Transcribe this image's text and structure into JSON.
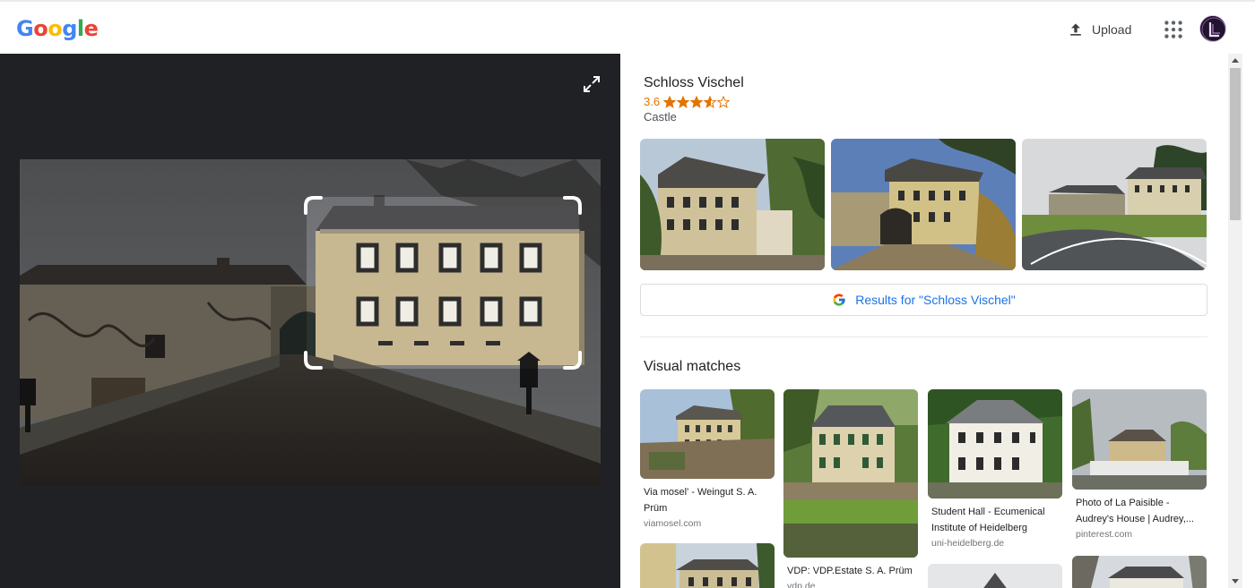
{
  "header": {
    "logo_letters": [
      {
        "ch": "G",
        "color": "#4285F4"
      },
      {
        "ch": "o",
        "color": "#EA4335"
      },
      {
        "ch": "o",
        "color": "#FBBC05"
      },
      {
        "ch": "g",
        "color": "#4285F4"
      },
      {
        "ch": "l",
        "color": "#34A853"
      },
      {
        "ch": "e",
        "color": "#EA4335"
      }
    ],
    "upload_label": "Upload",
    "upload_icon": "upload-icon",
    "apps_icon": "apps-grid-icon"
  },
  "viewer": {
    "expand_icon": "expand-icon",
    "background": "#202124"
  },
  "entity": {
    "title": "Schloss Vischel",
    "rating": "3.6",
    "stars_value": 3.6,
    "type": "Castle",
    "results_label": "Results for \"Schloss Vischel\""
  },
  "visual_matches": {
    "title": "Visual matches",
    "items": [
      {
        "caption": "Via mosel' - Weingut S. A. Prüm",
        "domain": "viamosel.com"
      },
      {
        "caption": "VDP: VDP.Estate S. A. Prüm",
        "domain": "vdp.de"
      },
      {
        "caption": "Student Hall - Ecumenical Institute of Heidelberg",
        "domain": "uni-heidelberg.de"
      },
      {
        "caption": "Photo of La Paisible - Audrey's House | Audrey,...",
        "domain": "pinterest.com"
      }
    ]
  },
  "colors": {
    "accent_blue": "#1a73e8",
    "star_orange": "#e37400"
  }
}
